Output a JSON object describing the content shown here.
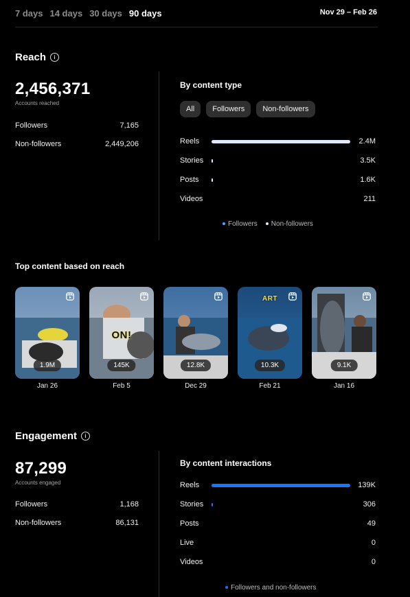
{
  "tabs": [
    {
      "label": "7 days",
      "active": false
    },
    {
      "label": "14 days",
      "active": false
    },
    {
      "label": "30 days",
      "active": false
    },
    {
      "label": "90 days",
      "active": true
    }
  ],
  "date_range": "Nov 29 – Feb 26",
  "reach": {
    "title": "Reach",
    "total": "2,456,371",
    "total_label": "Accounts reached",
    "followers_label": "Followers",
    "followers_value": "7,165",
    "nonfollowers_label": "Non-followers",
    "nonfollowers_value": "2,449,206",
    "by_type_title": "By content type",
    "filters": [
      "All",
      "Followers",
      "Non-followers"
    ],
    "rows": [
      {
        "label": "Reels",
        "value": "2.4M",
        "fraction": 1.0
      },
      {
        "label": "Stories",
        "value": "3.5K",
        "fraction": 0.01
      },
      {
        "label": "Posts",
        "value": "1.6K",
        "fraction": 0.005
      },
      {
        "label": "Videos",
        "value": "211",
        "fraction": 0.0
      }
    ],
    "legend": [
      "Followers",
      "Non-followers"
    ],
    "colors": {
      "followers": "#4da3ff",
      "nonfollowers": "#dfe9ff"
    }
  },
  "top_content": {
    "title": "Top content based on reach",
    "items": [
      {
        "count": "1.9M",
        "date": "Jan 26",
        "overlay": ""
      },
      {
        "count": "145K",
        "date": "Feb 5",
        "overlay": "ON!"
      },
      {
        "count": "12.8K",
        "date": "Dec 29",
        "overlay": ""
      },
      {
        "count": "10.3K",
        "date": "Feb 21",
        "overlay": "ART"
      },
      {
        "count": "9.1K",
        "date": "Jan 16",
        "overlay": ""
      }
    ]
  },
  "engagement": {
    "title": "Engagement",
    "total": "87,299",
    "total_label": "Accounts engaged",
    "followers_label": "Followers",
    "followers_value": "1,168",
    "nonfollowers_label": "Non-followers",
    "nonfollowers_value": "86,131",
    "by_interactions_title": "By content interactions",
    "rows": [
      {
        "label": "Reels",
        "value": "139K",
        "fraction": 1.0
      },
      {
        "label": "Stories",
        "value": "306",
        "fraction": 0.005
      },
      {
        "label": "Posts",
        "value": "49",
        "fraction": 0.0
      },
      {
        "label": "Live",
        "value": "0",
        "fraction": 0.0
      },
      {
        "label": "Videos",
        "value": "0",
        "fraction": 0.0
      }
    ],
    "legend": "Followers and non-followers",
    "color": "#1877f2"
  },
  "icons": {
    "info": "info-icon",
    "reel": "reel-icon"
  }
}
